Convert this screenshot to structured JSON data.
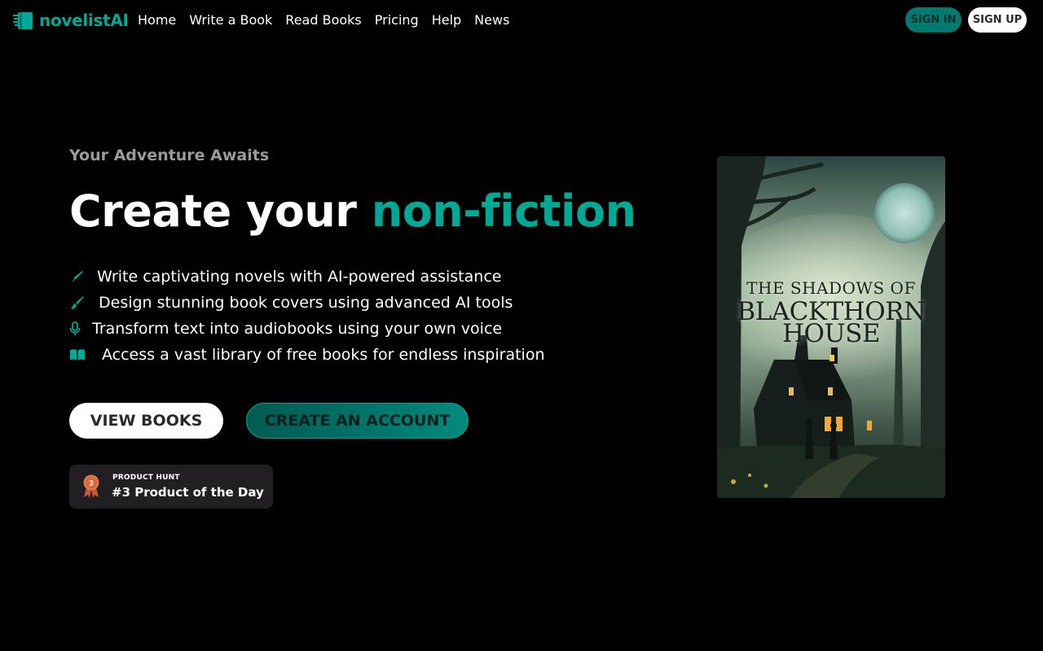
{
  "brand": {
    "name": "novelistAI",
    "accent": "#00a896"
  },
  "nav": {
    "links": [
      "Home",
      "Write a Book",
      "Read Books",
      "Pricing",
      "Help",
      "News"
    ],
    "sign_in": "SIGN IN",
    "sign_up": "SIGN UP"
  },
  "hero": {
    "eyebrow": "Your Adventure Awaits",
    "headline_prefix": "Create your",
    "headline_accent": "non-fiction",
    "features": [
      {
        "icon": "pen-icon",
        "text": "Write captivating novels with AI-powered assistance"
      },
      {
        "icon": "brush-icon",
        "text": "Design stunning book covers using advanced AI tools"
      },
      {
        "icon": "microphone-icon",
        "text": "Transform text into audiobooks using your own voice"
      },
      {
        "icon": "open-book-icon",
        "text": "Access a vast library of free books for endless inspiration"
      }
    ],
    "primary_button": "VIEW BOOKS",
    "secondary_button": "CREATE AN ACCOUNT"
  },
  "product_hunt": {
    "label": "PRODUCT HUNT",
    "rank": "3",
    "title": "#3 Product of the Day"
  },
  "book_cover": {
    "title_line1": "THE SHADOWS OF",
    "title_line2": "BLACKTHORN",
    "title_line3": "HOUSE"
  }
}
